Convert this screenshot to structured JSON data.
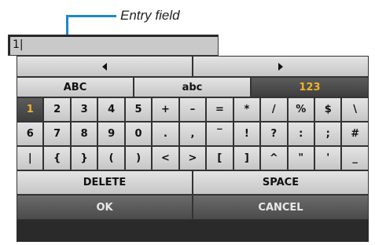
{
  "annotation": {
    "label": "Entry field"
  },
  "entry": {
    "value": "1|"
  },
  "nav": {
    "left_icon": "triangle-left-icon",
    "right_icon": "triangle-right-icon"
  },
  "tabs": [
    {
      "label": "ABC",
      "selected": false
    },
    {
      "label": "abc",
      "selected": false
    },
    {
      "label": "123",
      "selected": true
    }
  ],
  "keys": {
    "row1": [
      "1",
      "2",
      "3",
      "4",
      "5",
      "+",
      "–",
      "=",
      "*",
      "/",
      "%",
      "$",
      "\\"
    ],
    "row2": [
      "6",
      "7",
      "8",
      "9",
      "0",
      ".",
      ",",
      "‾",
      "!",
      "?",
      ":",
      ";",
      "#"
    ],
    "row3": [
      "|",
      "{",
      "}",
      "(",
      ")",
      "<",
      ">",
      "[",
      "]",
      "^",
      "\"",
      "'",
      "_"
    ]
  },
  "actions": {
    "delete": "DELETE",
    "space": "SPACE",
    "ok": "OK",
    "cancel": "CANCEL"
  },
  "colors": {
    "selected_text": "#f0b429",
    "annotation_line": "#1e88c7"
  }
}
